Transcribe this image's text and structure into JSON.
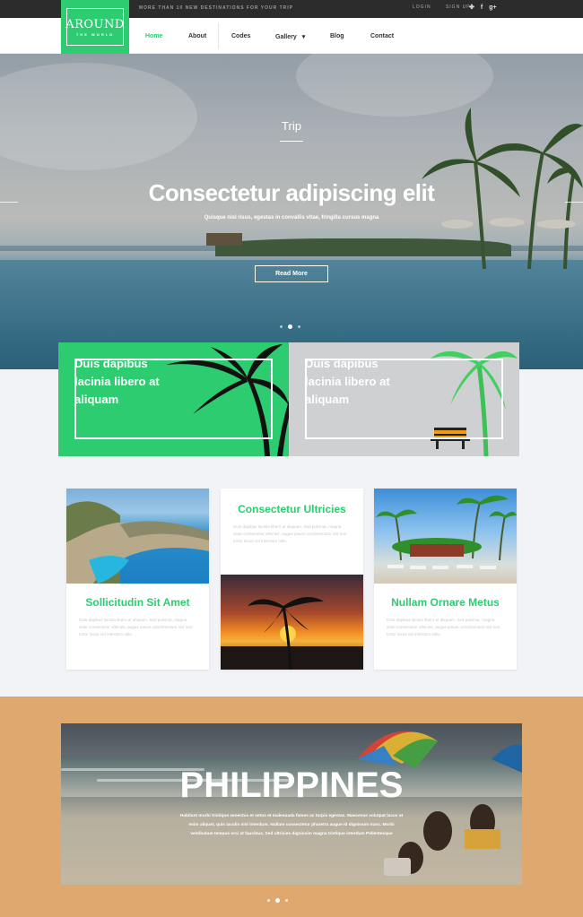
{
  "topbar": {
    "tagline": "MORE THAN 10 NEW DESTINATIONS FOR YOUR TRIP",
    "login": "LOGIN",
    "signup": "SIGN UP",
    "social": [
      "twitter-icon",
      "facebook-icon",
      "google-plus-icon"
    ],
    "social_glyphs": [
      "✤",
      "f",
      "g+"
    ]
  },
  "logo": {
    "main": "AROUND",
    "sub": "THE WORLD"
  },
  "nav": {
    "items": [
      "Home",
      "About",
      "Codes",
      "Gallery",
      "Blog",
      "Contact"
    ],
    "active": "Home",
    "gallery_caret": "▾"
  },
  "hero": {
    "kicker": "Trip",
    "title": "Consectetur adipiscing elit",
    "subtitle": "Quisque nisl risus, egestas in convallis vitae, fringilla cursus magna",
    "button": "Read More",
    "slide_count": 3,
    "active_slide": 2
  },
  "promos": [
    {
      "text": "Duis dapibus lacinia libero at aliquam"
    },
    {
      "text": "Duis dapibus lacinia libero at aliquam"
    }
  ],
  "cards": [
    {
      "title": "Sollicitudin Sit Amet",
      "text": "Duis dapibus lacinia libero at aliquam. Sed pulvinar, magna vitae consectetur ultricies, augue ipsum condimentum nisl non tortor lacus vel interdum odio."
    },
    {
      "title": "Consectetur Ultricies",
      "text": "Duis dapibus lacinia libero at aliquam. Sed pulvinar, magna vitae consectetur ultricies, augue ipsum condimentum nisl non tortor lacus vel interdum odio."
    },
    {
      "title": "Nullam Ornare Metus",
      "text": "Duis dapibus lacinia libero at aliquam. Sed pulvinar, magna vitae consectetur ultricies, augue ipsum condimentum nisl non tortor lacus vel interdum odio."
    }
  ],
  "destination": {
    "title": "PHILIPPINES",
    "text": "Habitant morbi tristique senectus et netus et malesuada fames ac turpis egestas. Maecenas volutpat lacus at enim aliquet, quis iaculis nisl interdum. Nullam consectetur pharetra augue id dignissim nunc. Morbi vestibulum tempus orci at faucibus. Sed ultricies dignissim magna tristique interdum Pellentesque",
    "slide_count": 3,
    "active_slide": 2
  },
  "colors": {
    "accent": "#2ecc71",
    "topbar": "#2c2c2c",
    "band": "#dea86e",
    "grey_promo": "#cfd0d2"
  }
}
